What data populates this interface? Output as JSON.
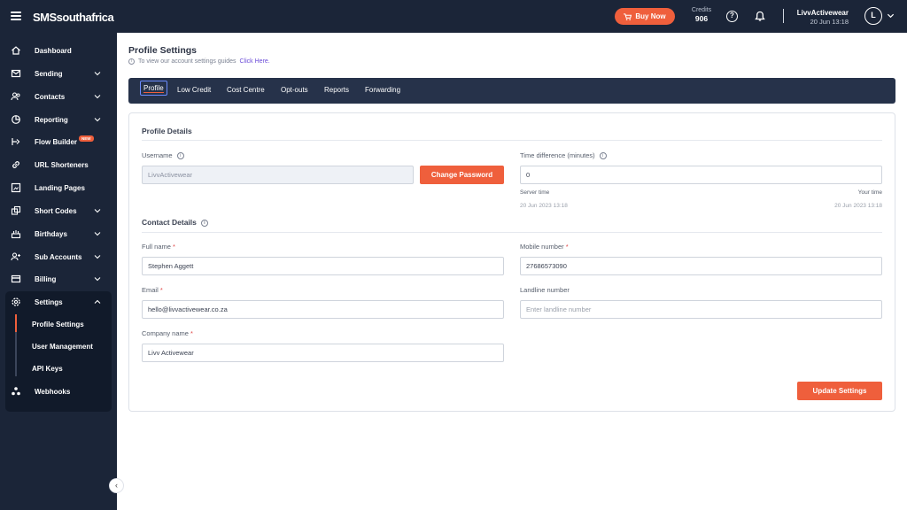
{
  "brand": "SMSsouthafrica",
  "topbar": {
    "buy_now": "Buy Now",
    "credits_label": "Credits",
    "credits_value": "906",
    "user_name": "LivvActivewear",
    "user_date": "20 Jun 13:18",
    "avatar_initial": "L"
  },
  "sidebar": {
    "items": [
      {
        "label": "Dashboard",
        "icon": "home-icon"
      },
      {
        "label": "Sending",
        "icon": "envelope-icon"
      },
      {
        "label": "Contacts",
        "icon": "users-icon"
      },
      {
        "label": "Reporting",
        "icon": "pie-chart-icon"
      },
      {
        "label": "Flow Builder",
        "icon": "flow-icon",
        "badge": "NEW"
      },
      {
        "label": "URL Shorteners",
        "icon": "link-icon"
      },
      {
        "label": "Landing Pages",
        "icon": "landing-page-icon"
      },
      {
        "label": "Short Codes",
        "icon": "short-codes-icon"
      },
      {
        "label": "Birthdays",
        "icon": "cake-icon"
      },
      {
        "label": "Sub Accounts",
        "icon": "user-plus-icon"
      },
      {
        "label": "Billing",
        "icon": "card-icon"
      },
      {
        "label": "Settings",
        "icon": "gear-icon"
      },
      {
        "label": "Webhooks",
        "icon": "webhook-icon"
      }
    ],
    "settings_sub": [
      "Profile Settings",
      "User Management",
      "API Keys"
    ],
    "collapse_glyph": "‹"
  },
  "page": {
    "title": "Profile Settings",
    "guide_text": "To view our account settings guides",
    "guide_link": "Click Here."
  },
  "tabs": [
    "Profile",
    "Low Credit",
    "Cost Centre",
    "Opt-outs",
    "Reports",
    "Forwarding"
  ],
  "profile": {
    "section_title": "Profile Details",
    "username_label": "Username",
    "username_value": "LivvActivewear",
    "change_password": "Change Password",
    "time_diff_label": "Time difference (minutes)",
    "time_diff_value": "0",
    "server_time_label": "Server time",
    "server_time_value": "20 Jun 2023 13:18",
    "your_time_label": "Your time",
    "your_time_value": "20 Jun 2023 13:18"
  },
  "contact": {
    "section_title": "Contact Details",
    "full_name_label": "Full name",
    "full_name_value": "Stephen Aggett",
    "mobile_label": "Mobile number",
    "mobile_value": "27686573090",
    "email_label": "Email",
    "email_value": "hello@livvactivewear.co.za",
    "landline_label": "Landline number",
    "landline_placeholder": "Enter landline number",
    "company_label": "Company name",
    "company_value": "Livv Activewear",
    "required_mark": "*"
  },
  "update_settings": "Update Settings",
  "colors": {
    "navy": "#1b2538",
    "accent": "#ef5f3c",
    "tab_bar": "#26324a"
  }
}
